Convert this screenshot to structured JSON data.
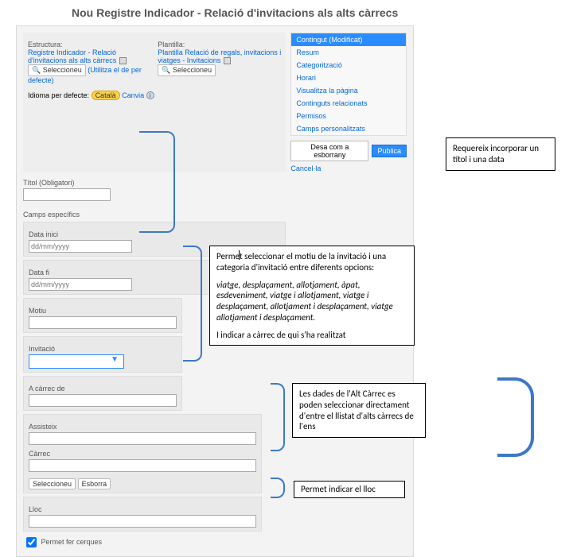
{
  "page_title": "Nou Registre Indicador - Relació d'invitacions als alts càrrecs",
  "structure": {
    "label": "Estructura:",
    "link_text": "Registre Indicador - Relació d'invitacions als alts càrrecs",
    "select_btn": "Seleccioneu",
    "use_default": "(Utilitza el de per defecte)"
  },
  "template": {
    "label": "Plantilla:",
    "link_text": "Plantilla Relació de regals, invitacions i viatges - Invitacions",
    "select_btn": "Seleccioneu"
  },
  "language": {
    "label": "Idioma per defecte:",
    "badge": "Català",
    "change": "Canvia"
  },
  "nav": {
    "items": [
      "Contingut (Modificat)",
      "Resum",
      "Categorització",
      "Horari",
      "Visualitza la pàgina",
      "Continguts relacionats",
      "Permisos",
      "Camps personalitzats"
    ],
    "draft_btn": "Desa com a esborrany",
    "publish_btn": "Publica",
    "cancel": "Cancel·la"
  },
  "fields": {
    "title_label": "Títol (Obligatori)",
    "specific_label": "Camps específics",
    "data_inici": "Data inici",
    "data_fi": "Data fi",
    "date_placeholder": "dd/mm/yyyy",
    "motiu": "Motiu",
    "invitacio": "Invitació",
    "a_carrec": "A càrrec de",
    "assisteix": "Assisteix",
    "carrec": "Càrrec",
    "select_btn": "Seleccioneu",
    "delete_btn": "Esborra",
    "lloc": "Lloc",
    "search_chk": "Permet fer cerques"
  },
  "annotations": {
    "a1": "Requereix incorporar un  títol i una data",
    "a2_p1": "Permet  seleccionar el motiu de la invitació i una categoria d'invitació entre diferents opcions:",
    "a2_p2": "viatge, desplaçament, allotjament, àpat, esdeveniment, viatge i allotjament, viatge i desplaçament, allotjament i desplaçament, viatge allotjament i desplaçament.",
    "a2_p3": "I indicar a càrrec de qui s'ha realitzat",
    "a3": "Les dades de l'Alt Càrrec es poden seleccionar directament d'entre el llistat d'alts càrrecs de l'ens",
    "a4": "Permet indicar el lloc"
  }
}
